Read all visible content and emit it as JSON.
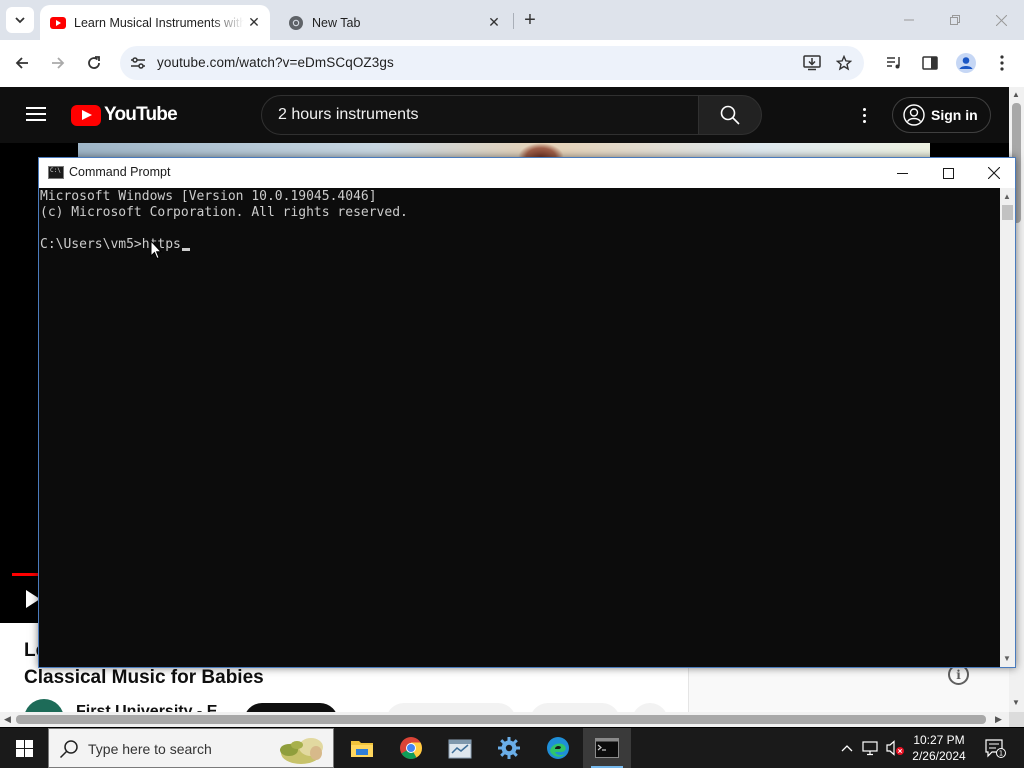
{
  "browser": {
    "tabs": [
      {
        "title": "Learn Musical Instruments with",
        "favicon": "youtube-icon",
        "active": true
      },
      {
        "title": "New Tab",
        "favicon": "chrome-icon",
        "active": false
      }
    ],
    "url": "youtube.com/watch?v=eDmSCqOZ3gs"
  },
  "youtube": {
    "logo_text": "YouTube",
    "search_query": "2 hours instruments",
    "sign_in_label": "Sign in",
    "video_title_line1": "Le",
    "video_title_line2": "Classical Music for Babies",
    "channel_name": "First University - E",
    "info_glyph": "i"
  },
  "cmd": {
    "window_title": "Command Prompt",
    "lines": [
      "Microsoft Windows [Version 10.0.19045.4046]",
      "(c) Microsoft Corporation. All rights reserved.",
      ""
    ],
    "prompt": "C:\\Users\\vm5>",
    "typed_input": "https"
  },
  "taskbar": {
    "search_placeholder": "Type here to search",
    "apps": [
      "file-explorer-icon",
      "chrome-icon",
      "notes-app-icon",
      "settings-icon",
      "edge-icon",
      "command-prompt-icon"
    ],
    "active_app": "command-prompt-icon",
    "time": "10:27 PM",
    "date": "2/26/2024",
    "notification_count": "1"
  },
  "colors": {
    "youtube_red": "#ff0000",
    "chrome_tabstrip": "#dee3eb",
    "omnibox": "#edf2fa",
    "cmd_background": "#0c0c0c",
    "cmd_text": "#cccccc",
    "taskbar": "#1a1a1a"
  }
}
